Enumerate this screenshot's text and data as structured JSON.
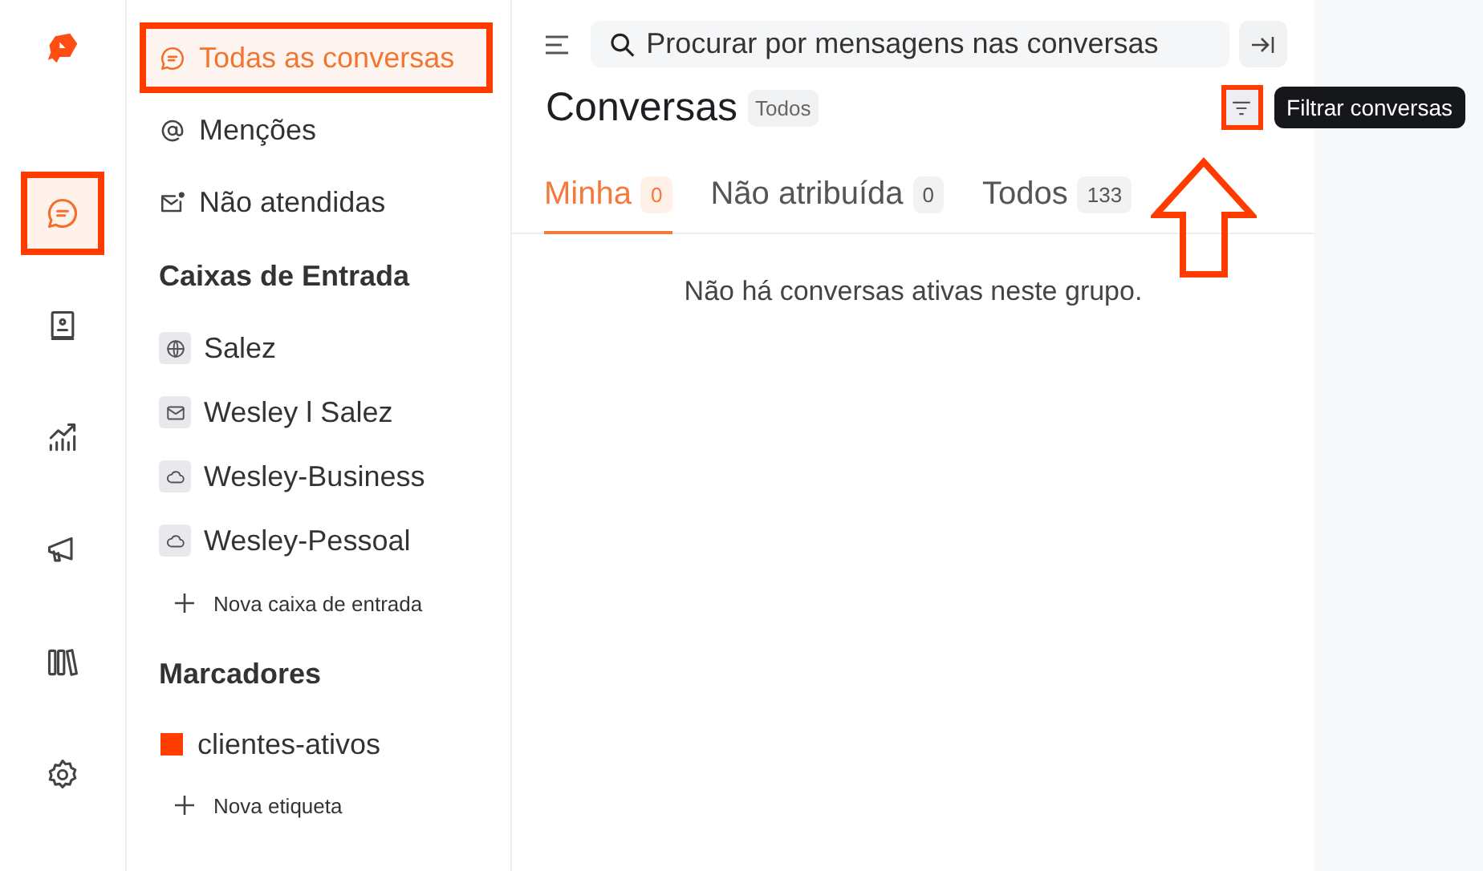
{
  "rail": {
    "items": [
      {
        "kind": "chat",
        "selected": true,
        "highlighted": true
      },
      {
        "kind": "contacts",
        "selected": false,
        "highlighted": false
      },
      {
        "kind": "reports",
        "selected": false,
        "highlighted": false
      },
      {
        "kind": "campaigns",
        "selected": false,
        "highlighted": false
      },
      {
        "kind": "library",
        "selected": false,
        "highlighted": false
      },
      {
        "kind": "settings",
        "selected": false,
        "highlighted": false
      }
    ]
  },
  "sidebar": {
    "items": [
      {
        "label": "Todas as conversas",
        "kind": "chat",
        "selected": true,
        "highlighted": true
      },
      {
        "label": "Menções",
        "kind": "mention",
        "selected": false,
        "highlighted": false
      },
      {
        "label": "Não atendidas",
        "kind": "unattended",
        "selected": false,
        "highlighted": false
      }
    ],
    "inboxes": {
      "heading": "Caixas de Entrada",
      "items": [
        {
          "label": "Salez",
          "kind": "web"
        },
        {
          "label": "Wesley l Salez",
          "kind": "email"
        },
        {
          "label": "Wesley-Business",
          "kind": "api"
        },
        {
          "label": "Wesley-Pessoal",
          "kind": "api"
        }
      ],
      "add_label": "Nova caixa de entrada"
    },
    "labels": {
      "heading": "Marcadores",
      "items": [
        {
          "label": "clientes-ativos",
          "color": "#ff3d00"
        }
      ],
      "add_label": "Nova etiqueta"
    }
  },
  "main": {
    "search": {
      "placeholder": "Procurar por mensagens nas conversas"
    },
    "title": "Conversas",
    "status_badge": "Todos",
    "filter_button": {
      "highlighted": true,
      "arrow": true
    },
    "tooltip": "Filtrar conversas",
    "tabs": [
      {
        "label": "Minha",
        "count": "0",
        "selected": true
      },
      {
        "label": "Não atribuída",
        "count": "0",
        "selected": false
      },
      {
        "label": "Todos",
        "count": "133",
        "selected": false
      }
    ],
    "empty_message": "Não há conversas ativas neste grupo."
  }
}
